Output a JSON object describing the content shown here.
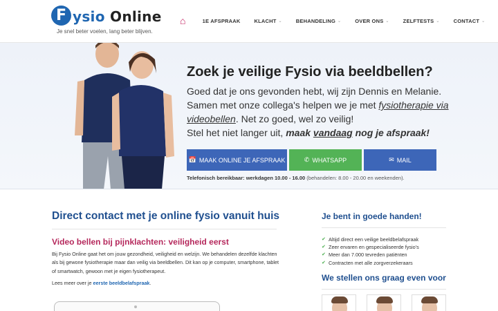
{
  "header": {
    "logo_letter": "F",
    "logo_word1": "ysio",
    "logo_word2": "Online",
    "tagline": "Je snel beter voelen, lang beter blijven.",
    "nav": [
      {
        "label": "1E AFSPRAAK",
        "has_dropdown": false
      },
      {
        "label": "KLACHT",
        "has_dropdown": true
      },
      {
        "label": "BEHANDELING",
        "has_dropdown": true
      },
      {
        "label": "OVER ONS",
        "has_dropdown": true
      },
      {
        "label": "ZELFTESTS",
        "has_dropdown": true
      },
      {
        "label": "CONTACT",
        "has_dropdown": true
      }
    ],
    "home_icon": "home-icon"
  },
  "hero": {
    "title": "Zoek je veilige Fysio via beeldbellen?",
    "body_before": "Goed dat je ons gevonden hebt, wij zijn Dennis en Melanie. Samen met onze collega's helpen we je met ",
    "body_link": "fysiotherapie via videobellen",
    "body_after": ". Net zo goed, wel zo veilig!",
    "cta_before": "Stel het niet langer uit, ",
    "cta_bold1": "maak ",
    "cta_underline": "vandaag",
    "cta_bold2": " nog je afspraak!",
    "buttons": {
      "online": "MAAK ONLINE JE AFSPRAAK",
      "whatsapp": "WHATSAPP",
      "mail": "MAIL"
    },
    "phone_bold": "Telefonisch bereikbaar: werkdagen 10.00 - 16.00",
    "phone_rest": " (behandelen: 8.00 - 20.00 en weekenden)."
  },
  "main": {
    "title": "Direct contact met je online fysio vanuit huis",
    "subtitle": "Video bellen bij pijnklachten: veiligheid eerst",
    "paragraph": "Bij Fysio Online gaat het om jouw gezondheid, veiligheid en welzijn. We behandelen dezelfde klachten als bij gewone fysiotherapie maar dan veilig via beeldbellen. Dit kan op je computer, smartphone, tablet of smartwatch, gewoon met je eigen fysiotherapeut.",
    "readmore_before": "Lees meer over je ",
    "readmore_link": "eerste beeldbelafspraak",
    "readmore_after": "."
  },
  "sidebar": {
    "title": "Je bent in goede handen!",
    "checklist": [
      "Altijd direct een veilige beeldbelafspraak",
      "Zeer ervaren en gespecialiseerde fysio's",
      "Meer dan 7.000 tevreden patiënten",
      "Contracten met alle zorgverzekeraars"
    ],
    "title2": "We stellen ons graag even voor"
  },
  "colors": {
    "brand_blue": "#1f66b1",
    "heading_blue": "#1f4f8f",
    "accent_pink": "#b5285c",
    "button_blue": "#3d66b8",
    "whatsapp_green": "#53b356"
  }
}
